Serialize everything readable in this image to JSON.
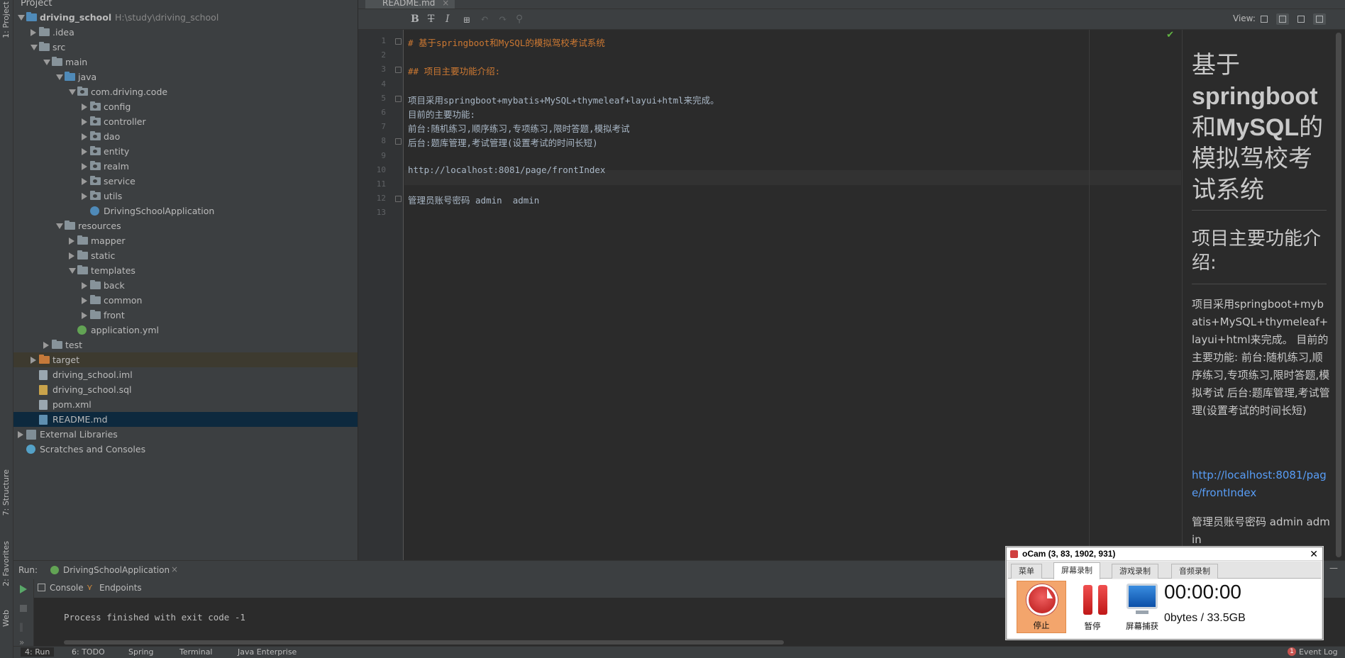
{
  "left_strip": {
    "project_tab": "1: Project",
    "structure_tab": "7: Structure",
    "favorites_tab": "2: Favorites",
    "web_tab": "Web"
  },
  "project_panel": {
    "title": "Project",
    "tree": [
      {
        "label": "driving_school",
        "path": "H:\\study\\driving_school",
        "bold": true
      },
      {
        "label": ".idea"
      },
      {
        "label": "src"
      },
      {
        "label": "main"
      },
      {
        "label": "java"
      },
      {
        "label": "com.driving.code"
      },
      {
        "label": "config"
      },
      {
        "label": "controller"
      },
      {
        "label": "dao"
      },
      {
        "label": "entity"
      },
      {
        "label": "realm"
      },
      {
        "label": "service"
      },
      {
        "label": "utils"
      },
      {
        "label": "DrivingSchoolApplication"
      },
      {
        "label": "resources"
      },
      {
        "label": "mapper"
      },
      {
        "label": "static"
      },
      {
        "label": "templates"
      },
      {
        "label": "back"
      },
      {
        "label": "common"
      },
      {
        "label": "front"
      },
      {
        "label": "application.yml"
      },
      {
        "label": "test"
      },
      {
        "label": "target"
      },
      {
        "label": "driving_school.iml"
      },
      {
        "label": "driving_school.sql"
      },
      {
        "label": "pom.xml"
      },
      {
        "label": "README.md"
      },
      {
        "label": "External Libraries"
      },
      {
        "label": "Scratches and Consoles"
      }
    ]
  },
  "editor": {
    "tab_label": "README.md",
    "toolbar": {
      "bold": "B",
      "strike": "T",
      "italic": "I",
      "view_label": "View:"
    },
    "lines": [
      {
        "n": "1",
        "text": "# 基于springboot和MySQL的模拟驾校考试系统"
      },
      {
        "n": "2",
        "text": ""
      },
      {
        "n": "3",
        "text": "## 项目主要功能介绍:"
      },
      {
        "n": "4",
        "text": ""
      },
      {
        "n": "5",
        "text": "项目采用springboot+mybatis+MySQL+thymeleaf+layui+html来完成。"
      },
      {
        "n": "6",
        "text": "目前的主要功能:"
      },
      {
        "n": "7",
        "text": "前台:随机练习,顺序练习,专项练习,限时答题,模拟考试"
      },
      {
        "n": "8",
        "text": "后台:题库管理,考试管理(设置考试的时间长短)"
      },
      {
        "n": "9",
        "text": ""
      },
      {
        "n": "10",
        "text": "http://localhost:8081/page/frontIndex"
      },
      {
        "n": "11",
        "text": ""
      },
      {
        "n": "12",
        "text": "管理员账号密码 admin  admin"
      },
      {
        "n": "13",
        "text": ""
      }
    ]
  },
  "preview": {
    "h1_part1": "基于",
    "h1_part2": "springboot",
    "h1_part3": "和",
    "h1_part4": "MySQL",
    "h1_part5": "的模拟驾校考试系统",
    "h2": "项目主要功能介绍:",
    "para": "项目采用springboot+mybatis+MySQL+thymeleaf+layui+html来完成。 目前的主要功能: 前台:随机练习,顺序练习,专项练习,限时答题,模拟考试 后台:题库管理,考试管理(设置考试的时间长短)",
    "link": "http://localhost:8081/page/frontIndex",
    "admin": "管理员账号密码 admin admin"
  },
  "run": {
    "label": "Run:",
    "config": "DrivingSchoolApplication",
    "console_tab": "Console",
    "endpoints_tab": "Endpoints",
    "output": "Process finished with exit code -1"
  },
  "status_tabs": {
    "run": "4: Run",
    "todo": "6: TODO",
    "spring": "Spring",
    "terminal": "Terminal",
    "java_ee": "Java Enterprise",
    "event_log": "Event Log",
    "event_count": "1"
  },
  "ocam": {
    "title": "oCam (3, 83, 1902, 931)",
    "tabs": [
      "菜单",
      "屏幕录制",
      "游戏录制",
      "音频录制"
    ],
    "stop_label": "停止",
    "pause_label": "暂停",
    "capture_label": "屏幕捕获",
    "time": "00:00:00",
    "size": "0bytes / 33.5GB"
  }
}
